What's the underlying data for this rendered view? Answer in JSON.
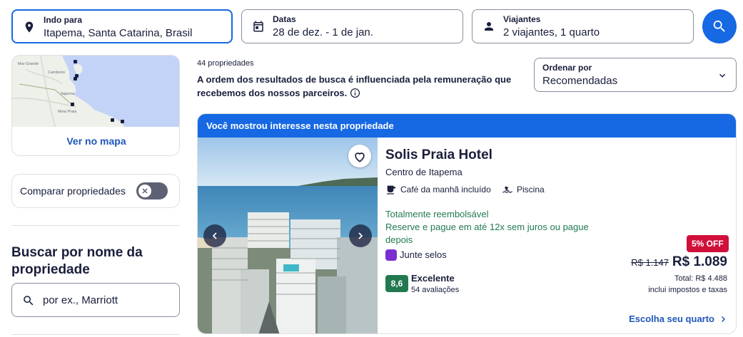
{
  "search": {
    "destination": {
      "label": "Indo para",
      "value": "Itapema, Santa Catarina, Brasil",
      "icon": "location-pin-icon"
    },
    "dates": {
      "label": "Datas",
      "value": "28 de dez. - 1 de jan.",
      "icon": "calendar-icon"
    },
    "travelers": {
      "label": "Viajantes",
      "value": "2 viajantes, 1 quarto",
      "icon": "person-icon"
    },
    "search_icon": "search-icon"
  },
  "sidebar": {
    "map": {
      "link": "Ver no mapa",
      "labels": [
        "Mar Grande",
        "Camboriú",
        "Itapema",
        "Meia Praia"
      ]
    },
    "compare": {
      "label": "Comparar propriedades",
      "toggle_on": false
    },
    "name_search": {
      "title": "Buscar por nome da propriedade",
      "placeholder": "por ex., Marriott"
    }
  },
  "results": {
    "count": "44 propriedades",
    "notice": "A ordem dos resultados de busca é influenciada pela remuneração que recebemos dos nossos parceiros.",
    "sort": {
      "label": "Ordenar por",
      "value": "Recomendadas"
    }
  },
  "property": {
    "banner": "Você mostrou interesse nesta propriedade",
    "name": "Solis Praia Hotel",
    "location": "Centro de Itapema",
    "amenities": [
      {
        "label": "Café da manhã incluído",
        "icon": "coffee-icon"
      },
      {
        "label": "Piscina",
        "icon": "pool-icon"
      }
    ],
    "refundable": "Totalmente reembolsável",
    "installments_line1": "Reserve e pague em até 12x sem juros ou pague",
    "installments_line2": "depois",
    "stamps": "Junte selos",
    "rating": {
      "score": "8,6",
      "label": "Excelente",
      "reviews": "54 avaliações"
    },
    "discount": "5% OFF",
    "old_price": "R$ 1.147",
    "price": "R$ 1.089",
    "total": "Total: R$ 4.488",
    "taxes": "inclui impostos e taxas",
    "cta": "Escolha seu quarto"
  },
  "colors": {
    "brand_blue": "#1668e3",
    "green": "#227950",
    "discount_red": "#d0103a",
    "link_blue": "#1f57b8"
  }
}
